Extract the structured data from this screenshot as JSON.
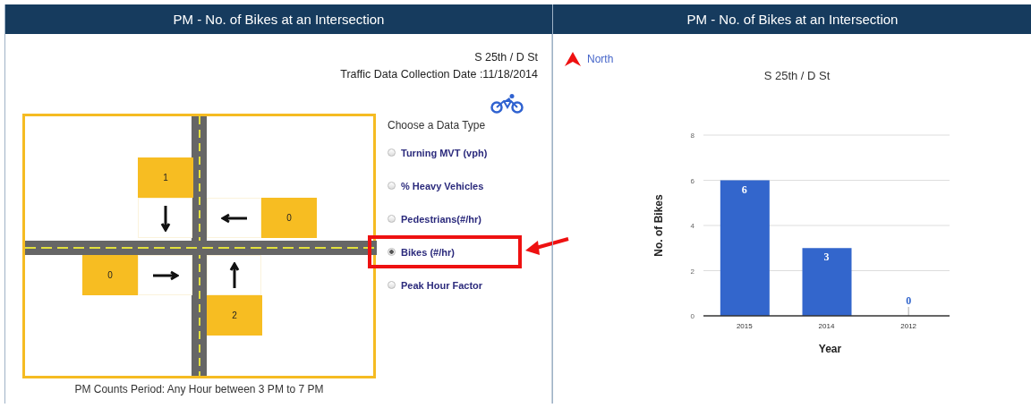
{
  "left_panel": {
    "title": "PM - No. of Bikes at an Intersection",
    "location": "S 25th / D St",
    "collection_date": "Traffic Data Collection Date :11/18/2014",
    "intersection": {
      "approaches": [
        {
          "kind": "north",
          "count": "1"
        },
        {
          "kind": "east",
          "count": "0"
        },
        {
          "kind": "west",
          "count": "0"
        },
        {
          "kind": "south",
          "count": "2"
        }
      ],
      "caption": "PM Counts Period: Any Hour between 3 PM to 7 PM"
    },
    "data_type": {
      "label": "Choose a Data Type",
      "options": [
        {
          "label": "Turning MVT (vph)",
          "selected": false,
          "highlighted": false
        },
        {
          "label": "% Heavy Vehicles",
          "selected": false,
          "highlighted": false
        },
        {
          "label": "Pedestrians(#/hr)",
          "selected": false,
          "highlighted": false
        },
        {
          "label": "Bikes (#/hr)",
          "selected": true,
          "highlighted": true
        },
        {
          "label": "Peak Hour Factor",
          "selected": false,
          "highlighted": false
        }
      ]
    }
  },
  "right_panel": {
    "title": "PM - No. of Bikes at an Intersection",
    "compass": "North",
    "chart_data": {
      "type": "bar",
      "title": "S 25th / D St",
      "xlabel": "Year",
      "ylabel": "No. of Bikes",
      "categories": [
        "2015",
        "2014",
        "2012"
      ],
      "series": [
        {
          "color": "#3366cc",
          "values": [
            6,
            3,
            0
          ]
        }
      ],
      "grid": true,
      "ylim": [
        0,
        8
      ],
      "yticks": [
        0,
        2,
        4,
        6,
        8
      ],
      "data_labels": true
    }
  }
}
